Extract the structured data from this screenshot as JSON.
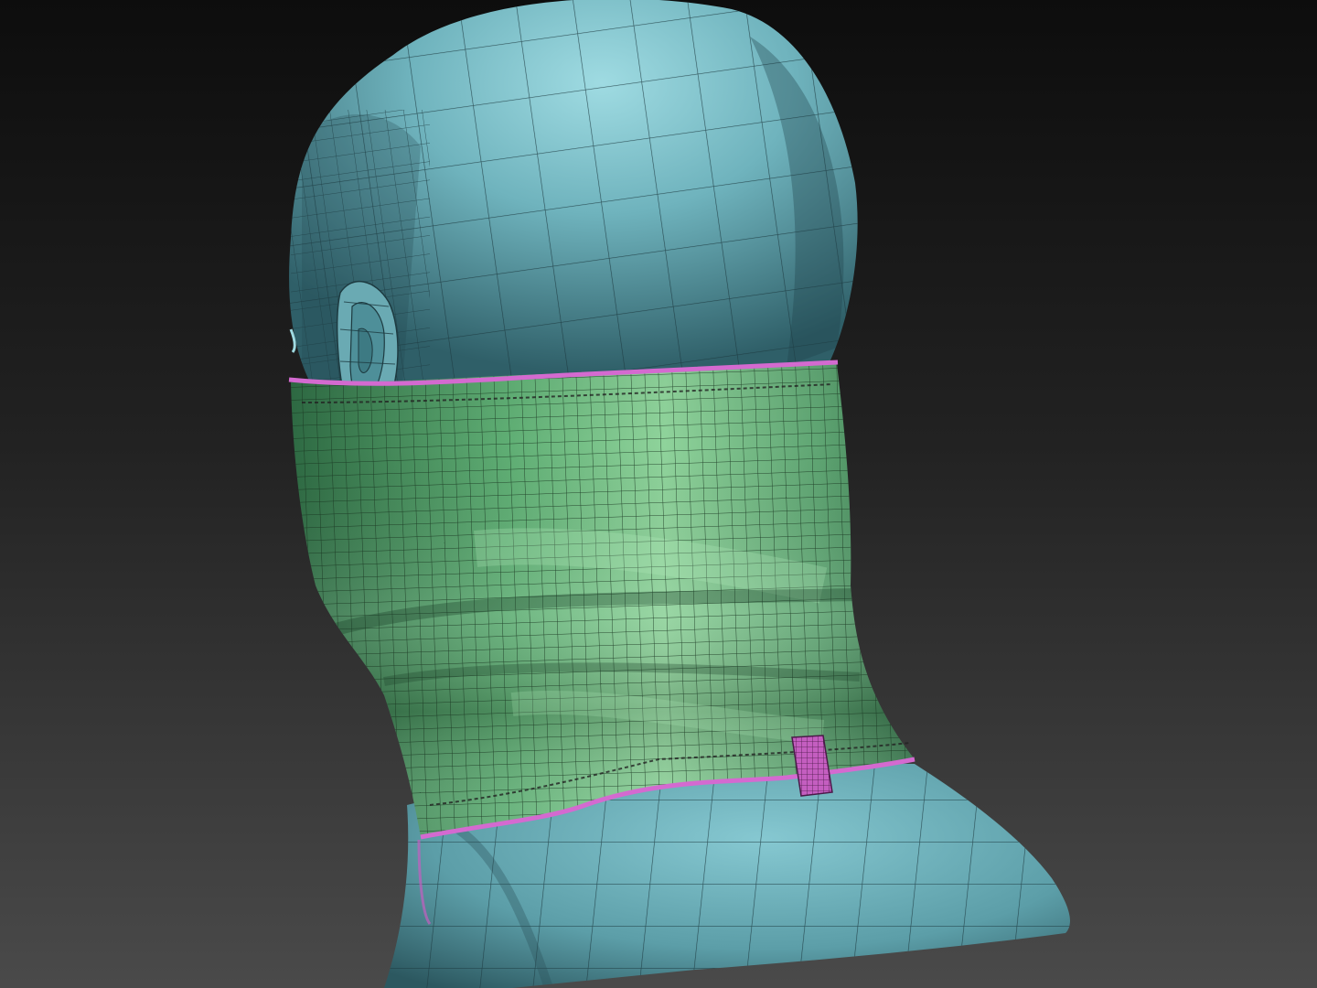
{
  "scene": {
    "subject": "head-with-neck-gaiter",
    "colors": {
      "background_top": "#0d0d0d",
      "background_bottom": "#4a4a4a",
      "head_light": "#8fd3db",
      "head_mid": "#5fa6b0",
      "head_dark": "#2f5f68",
      "gaiter_light": "#9ee0a8",
      "gaiter_mid": "#5fae74",
      "gaiter_dark": "#2e6a43",
      "trim": "#d46ad0",
      "tag": "#c45ec0",
      "wire": "#1d3a40"
    }
  }
}
